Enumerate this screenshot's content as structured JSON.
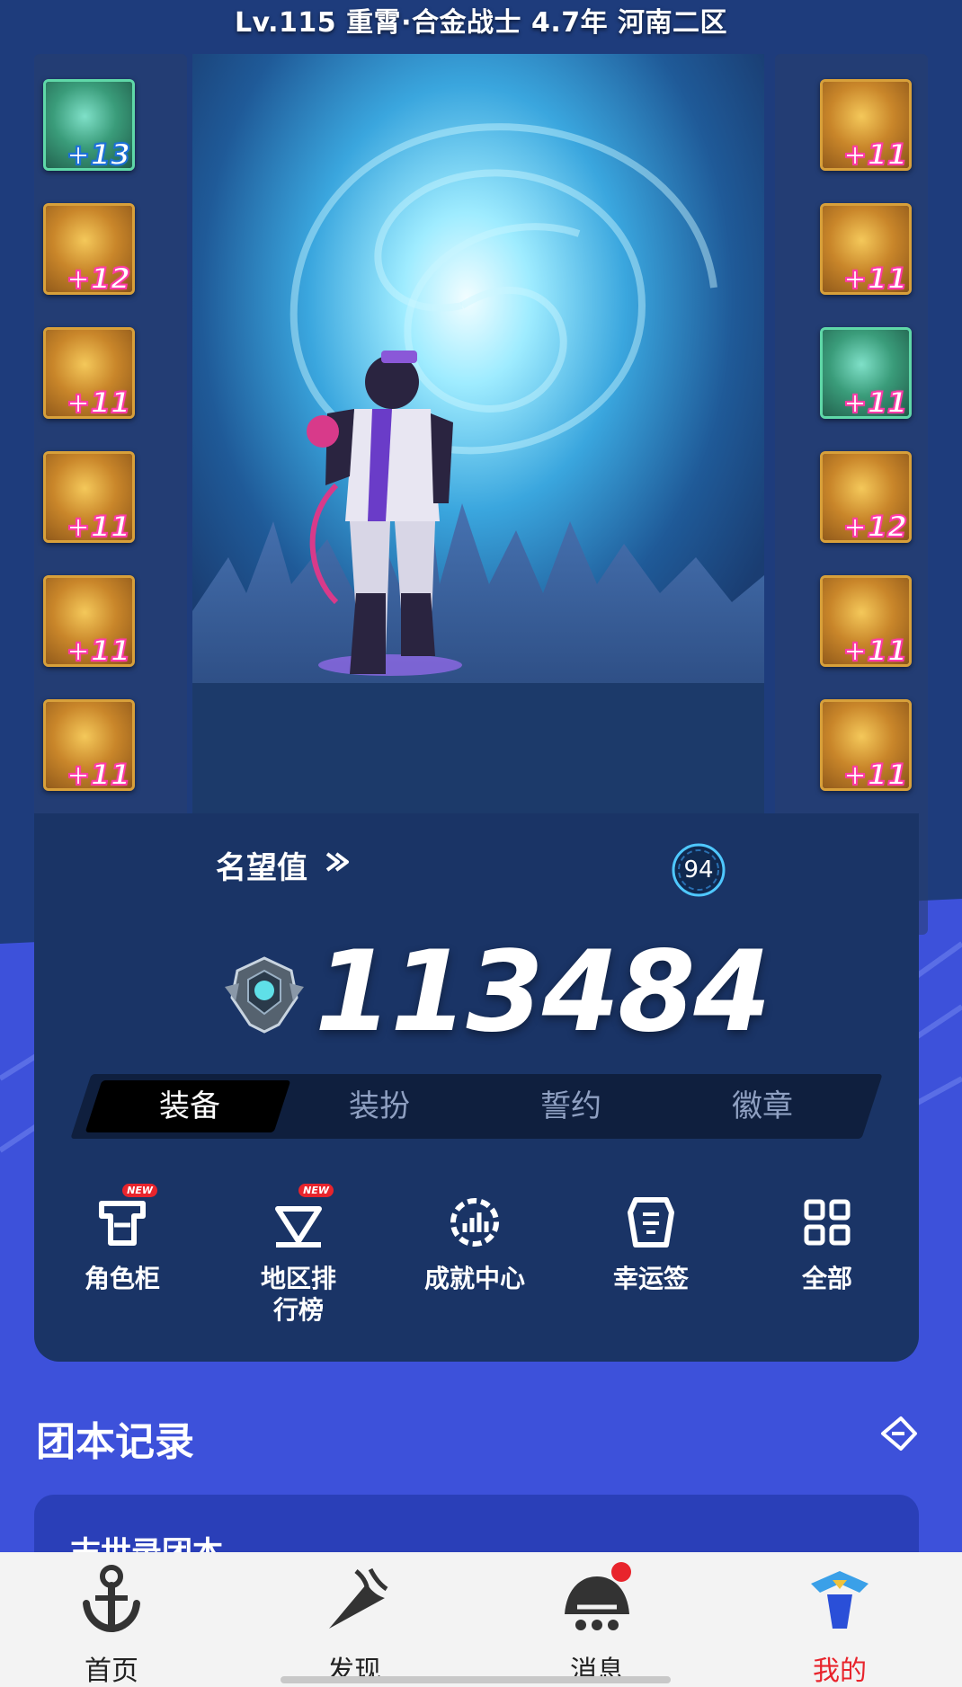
{
  "header": {
    "level_line": "Lv.115 重霄·合金战士 4.7年 河南二区"
  },
  "colors": {
    "accent": "#3e52dc",
    "card": "#1a3466",
    "active_nav": "#e8242c",
    "plus_pink": "#ff3aa8"
  },
  "equipment": {
    "left": [
      {
        "name": "weapon-icon",
        "plus": "+13",
        "tone": "green"
      },
      {
        "name": "shoulder-armor-icon",
        "plus": "+12",
        "tone": "gold"
      },
      {
        "name": "chest-armor-icon",
        "plus": "+11",
        "tone": "gold"
      },
      {
        "name": "pants-armor-icon",
        "plus": "+11",
        "tone": "gold"
      },
      {
        "name": "belt-armor-icon",
        "plus": "+11",
        "tone": "gold"
      },
      {
        "name": "boots-armor-icon",
        "plus": "+11",
        "tone": "gold"
      },
      {
        "name": "avatar-title-icon",
        "plus": "",
        "tone": "purple"
      }
    ],
    "right": [
      {
        "name": "bracelet-icon",
        "plus": "+11",
        "tone": "gold"
      },
      {
        "name": "necklace-icon",
        "plus": "+11",
        "tone": "gold"
      },
      {
        "name": "ring-icon",
        "plus": "+11",
        "tone": "green"
      },
      {
        "name": "support-icon",
        "plus": "+12",
        "tone": "gold"
      },
      {
        "name": "magic-stone-icon",
        "plus": "+11",
        "tone": "gold"
      },
      {
        "name": "earring-icon",
        "plus": "+11",
        "tone": "gold"
      },
      {
        "name": "pet-icon",
        "plus": "",
        "tone": "purple"
      }
    ]
  },
  "fame": {
    "label": "名望值",
    "badge_value": "94",
    "score": "113484"
  },
  "tabs": [
    "装备",
    "装扮",
    "誓约",
    "徽章"
  ],
  "actions": [
    {
      "label": "角色柜",
      "icon": "wardrobe-icon",
      "new": "NEW"
    },
    {
      "label": "地区排\n行榜",
      "icon": "ranking-icon",
      "new": "NEW"
    },
    {
      "label": "成就中心",
      "icon": "achievement-icon",
      "new": ""
    },
    {
      "label": "幸运签",
      "icon": "lucky-lot-icon",
      "new": ""
    },
    {
      "label": "全部",
      "icon": "grid-icon",
      "new": ""
    }
  ],
  "section": {
    "title": "团本记录",
    "record_title": "末世录团本"
  },
  "nav": [
    {
      "label": "首页",
      "icon": "anchor-home-icon"
    },
    {
      "label": "发现",
      "icon": "discover-icon"
    },
    {
      "label": "消息",
      "icon": "message-icon"
    },
    {
      "label": "我的",
      "icon": "profile-emblem-icon"
    }
  ]
}
